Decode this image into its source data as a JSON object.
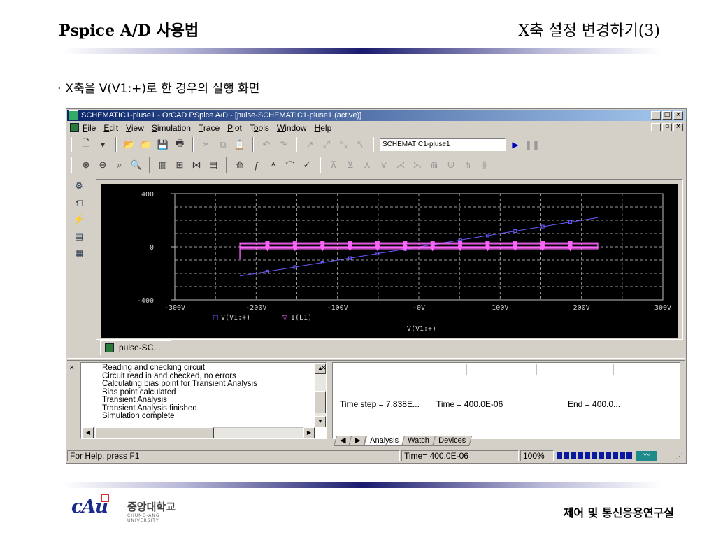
{
  "slide": {
    "title_left": "Pspice A/D 사용법",
    "title_right": "X축 설정 변경하기(3)",
    "bullet_marker": "·",
    "bullet": "X축을 V(V1:+)로 한 경우의 실행 화면",
    "footer_lab": "제어 및 통신응용연구실",
    "logo_mark": "cAu",
    "logo_korean": "중앙대학교",
    "logo_english": "CHUNG-ANG UNIVERSITY"
  },
  "window": {
    "title": "SCHEMATIC1-pluse1 - OrCAD PSpice A/D  - [pulse-SCHEMATIC1-pluse1 (active)]",
    "controls": [
      "_",
      "□",
      "×"
    ],
    "doc_controls": [
      "_",
      "▫",
      "×"
    ]
  },
  "menu": [
    {
      "ul": "F",
      "rest": "ile"
    },
    {
      "ul": "E",
      "rest": "dit"
    },
    {
      "ul": "V",
      "rest": "iew"
    },
    {
      "ul": "S",
      "rest": "imulation"
    },
    {
      "ul": "T",
      "rest": "race"
    },
    {
      "ul": "P",
      "rest": "lot"
    },
    {
      "pre": "T",
      "ul": "o",
      "rest": "ols"
    },
    {
      "ul": "W",
      "rest": "indow"
    },
    {
      "ul": "H",
      "rest": "elp"
    }
  ],
  "toolbar": {
    "profile_value": "SCHEMATIC1-pluse1",
    "run_icon": "play-icon",
    "pause_icon": "pause-icon"
  },
  "plot": {
    "background": "#000000",
    "grid_color": "#9a9a9a",
    "y_ticks": [
      "400",
      "0",
      "-400"
    ],
    "x_ticks": [
      "-300V",
      "-200V",
      "-100V",
      "-0V",
      "100V",
      "200V",
      "300V"
    ],
    "x_axis_label": "V(V1:+)",
    "legend": [
      {
        "marker": "□",
        "name": "V(V1:+)",
        "color": "#6a5cff"
      },
      {
        "marker": "▽",
        "name": "I(L1)",
        "color": "#ff66ff"
      }
    ]
  },
  "chart_data": {
    "type": "line",
    "xlim": [
      -300,
      300
    ],
    "ylim": [
      -400,
      400
    ],
    "x_unit": "V",
    "grid": true,
    "series": [
      {
        "name": "V(V1:+)",
        "color": "#6a5cff",
        "x": [
          -220,
          220
        ],
        "y": [
          -220,
          220
        ]
      },
      {
        "name": "I(L1)",
        "color": "#ff66ff",
        "x": [
          -220,
          -220,
          220,
          220,
          -220,
          -220,
          220,
          220,
          -220,
          -220,
          220,
          220,
          -220
        ],
        "y": [
          -90,
          30,
          30,
          0,
          0,
          25,
          25,
          -15,
          -15,
          15,
          15,
          -5,
          -5
        ]
      }
    ]
  },
  "doc_tab": "pulse-SC...",
  "output_log": [
    "Reading and checking circuit",
    "Circuit read in and checked, no errors",
    "Calculating bias point for Transient Analysis",
    "Bias point calculated",
    "Transient Analysis",
    "Transient Analysis finished",
    "Simulation complete"
  ],
  "sim_status": {
    "time_step": "Time step = 7.838E...",
    "time": "Time = 400.0E-06",
    "end": "End = 400.0..."
  },
  "sim_tabs": [
    "Analysis",
    "Watch",
    "Devices"
  ],
  "statusbar": {
    "help": "For Help, press F1",
    "time": "Time= 400.0E-06",
    "percent": "100%",
    "progress": 1.0
  }
}
